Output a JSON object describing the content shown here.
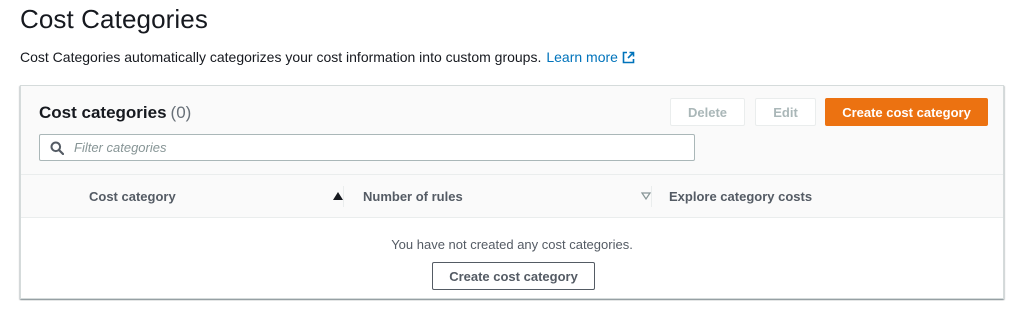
{
  "page": {
    "title": "Cost Categories",
    "description": "Cost Categories automatically categorizes your cost information into custom groups.",
    "learn_more": "Learn more"
  },
  "panel": {
    "title": "Cost categories",
    "count": "(0)",
    "buttons": {
      "delete": "Delete",
      "edit": "Edit",
      "create": "Create cost category"
    },
    "filter": {
      "placeholder": "Filter categories",
      "value": ""
    }
  },
  "table": {
    "columns": [
      "Cost category",
      "Number of rules",
      "Explore category costs"
    ],
    "empty_message": "You have not created any cost categories.",
    "empty_action": "Create cost category"
  },
  "colors": {
    "primary": "#ec7211",
    "link": "#0073bb",
    "disabled": "#aab7b8"
  }
}
